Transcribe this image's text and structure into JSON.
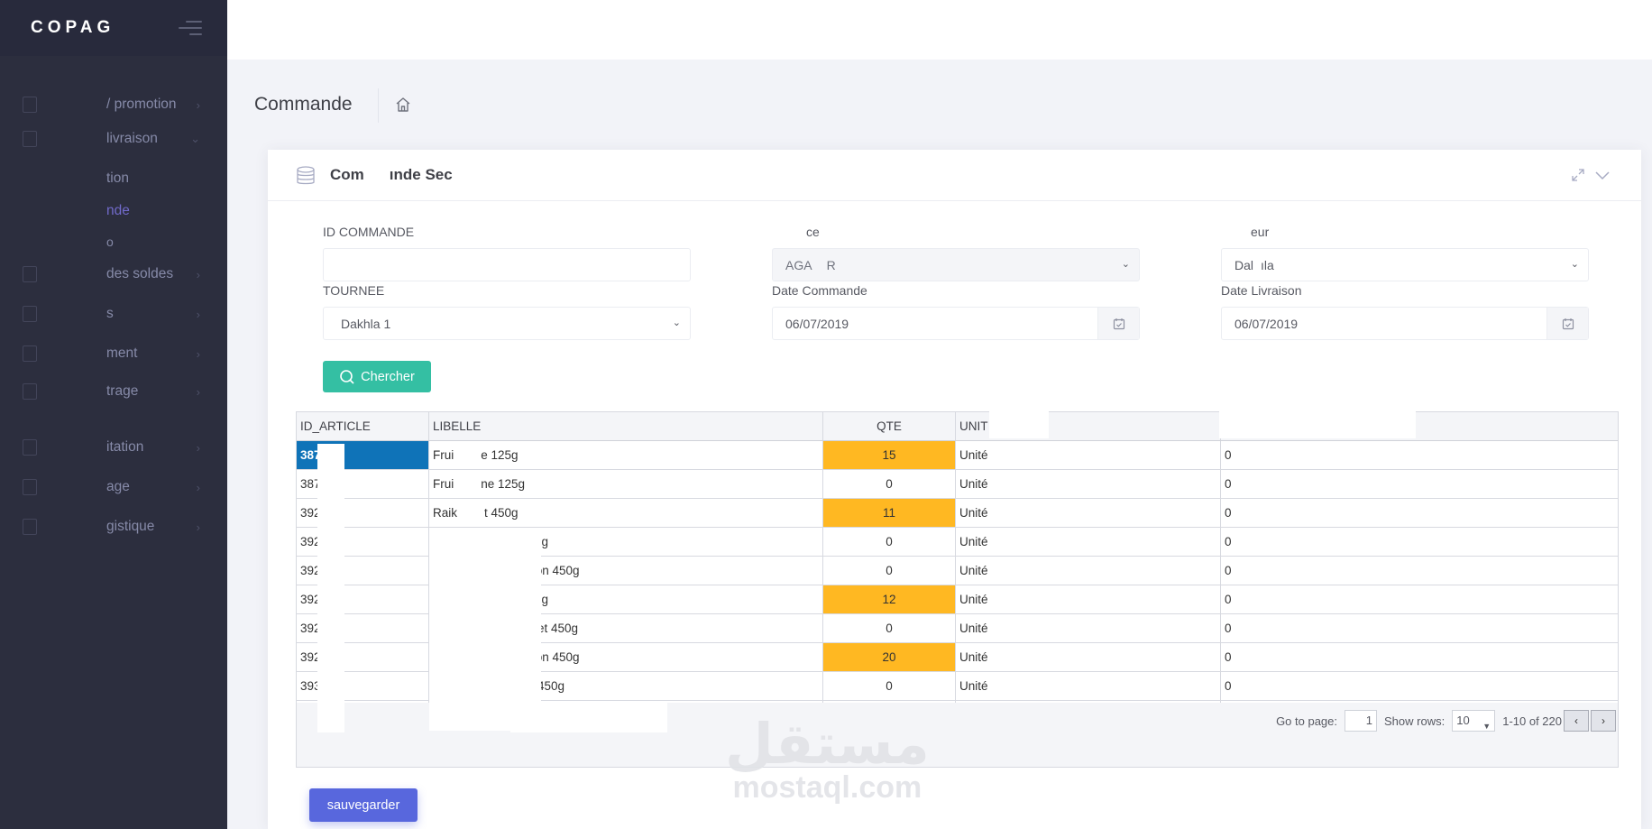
{
  "app": {
    "logo": "COPAG"
  },
  "sidebar": {
    "items": [
      {
        "label": "/ promotion",
        "chev": "›"
      },
      {
        "label": "livraison",
        "chev": "⌄"
      },
      {
        "label": "des soldes",
        "chev": "›"
      },
      {
        "label": "s",
        "chev": "›"
      },
      {
        "label": "ment",
        "chev": "›"
      },
      {
        "label": "trage",
        "chev": "›"
      },
      {
        "label": "itation",
        "chev": "›"
      },
      {
        "label": "age",
        "chev": "›"
      },
      {
        "label": "gistique",
        "chev": "›"
      }
    ],
    "submenu": [
      "tion",
      "nde",
      "o"
    ]
  },
  "page": {
    "title": "Commande"
  },
  "portlet": {
    "title_part1": "Com",
    "title_part2": "ınde Sec"
  },
  "form": {
    "id_commande_label": "ID COMMANDE",
    "id_commande_value": "",
    "centre_label": "ce",
    "centre_value_a": "AGA",
    "centre_value_b": "R",
    "vendeur_label": "eur",
    "vendeur_value_a": "Dal",
    "vendeur_value_b": "ıla",
    "tournee_label": "TOURNEE",
    "tournee_value": "Dakhla 1",
    "date_commande_label": "Date Commande",
    "date_commande_value": "06/07/2019",
    "date_livraison_label": "Date Livraison",
    "date_livraison_value": "06/07/2019",
    "search_button": "Chercher",
    "save_button": "sauvegarder"
  },
  "grid": {
    "headers": [
      "ID_ARTICLE",
      "LIBELLE",
      "QTE",
      "UNIT",
      ""
    ],
    "rows": [
      {
        "id": "387",
        "libelle": "Frui",
        "libelle2": "e 125g",
        "qte": "15",
        "unit": "Unité",
        "val": "0",
        "hi": true,
        "sel": true
      },
      {
        "id": "387",
        "libelle": "Frui",
        "libelle2": "ne 125g",
        "qte": "0",
        "unit": "Unité",
        "val": "0",
        "hi": false,
        "sel": false
      },
      {
        "id": "392",
        "libelle": "Raik",
        "libelle2": "t 450g",
        "qte": "11",
        "unit": "Unité",
        "val": "0",
        "hi": true,
        "sel": false
      },
      {
        "id": "392",
        "libelle": "",
        "libelle2": "450g",
        "qte": "0",
        "unit": "Unité",
        "val": "0",
        "hi": false,
        "sel": false
      },
      {
        "id": "392",
        "libelle": "",
        "libelle2": "arton 450g",
        "qte": "0",
        "unit": "Unité",
        "val": "0",
        "hi": false,
        "sel": false
      },
      {
        "id": "392",
        "libelle": "",
        "libelle2": "450g",
        "qte": "12",
        "unit": "Unité",
        "val": "0",
        "hi": true,
        "sel": false
      },
      {
        "id": "392",
        "libelle": "",
        "libelle2": "ıchet 450g",
        "qte": "0",
        "unit": "Unité",
        "val": "0",
        "hi": false,
        "sel": false
      },
      {
        "id": "392",
        "libelle": "",
        "libelle2": "arton 450g",
        "qte": "20",
        "unit": "Unité",
        "val": "0",
        "hi": true,
        "sel": false
      },
      {
        "id": "393",
        "libelle": "",
        "libelle2": "ns 450g",
        "qte": "0",
        "unit": "Unité",
        "val": "0",
        "hi": false,
        "sel": false
      },
      {
        "id": "393",
        "libelle": "",
        "libelle2": "",
        "qte": "0",
        "unit": "Unité",
        "val": "0",
        "hi": false,
        "sel": false
      }
    ],
    "pager": {
      "goto_label": "Go to page:",
      "page": "1",
      "rows_label": "Show rows:",
      "rows": "10",
      "range": "1-10 of 220",
      "prev": "‹",
      "next": "›"
    }
  },
  "watermark": {
    "ar": "مستقل",
    "en": "mostaql.com"
  },
  "colors": {
    "accent": "#5867dd",
    "success": "#34bfa3",
    "warning": "#ffb822",
    "selected": "#0f73b8"
  }
}
